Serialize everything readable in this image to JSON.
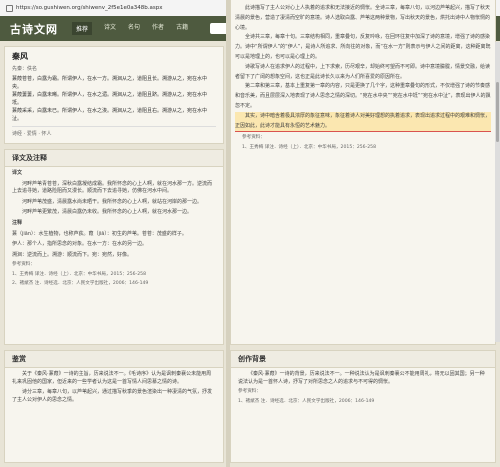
{
  "url": "https://so.gushiwen.org/shiwenv_2f5e1e0a348b.aspx",
  "site": {
    "logo": "古诗文网",
    "nav": [
      "推荐",
      "诗文",
      "名句",
      "作者",
      "古籍"
    ]
  },
  "poem": {
    "title": "秦风",
    "meta": "先秦：佚名",
    "lines": [
      "蒹葭苍苍，白露为霜。所谓伊人，在水一方。溯洄从之，道阻且长。溯游从之，宛在水中央。",
      "蒹葭萋萋，白露未晞。所谓伊人，在水之湄。溯洄从之，道阻且跻。溯游从之，宛在水中坻。",
      "蒹葭采采，白露未已。所谓伊人，在水之涘。溯洄从之，道阻且右。溯游从之，宛在水中沚。"
    ],
    "tags": "诗经 · 爱情 · 怀人"
  },
  "notes": {
    "header": "译文及注释",
    "sub": "译文",
    "text": [
      "河畔芦苇青苍苍，深秋白露凝结成霜。我所怀念的心上人啊，就在河水那一方。逆流而上去追寻她，道路险阻而又漫长。顺流而下去追寻她，仿佛在河水中间。",
      "河畔芦苇茂盛，清晨露水尚未晒干。我所怀念的心上人啊，就站在河岸的那一边。",
      "河畔芦苇更繁茂，清晨白露仍未收。我所怀念的心上人啊，就在河水那一边。"
    ],
    "ann": "注释",
    "notes_list": [
      "蒹（jiān）：水生植物，也称芦荻。葭（jiā）：初生的芦苇。苍苍：茂盛的样子。",
      "伊人：那个人，指所思念的对象。在水一方：在水的另一边。",
      "溯洄：逆流而上。溯游：顺流而下。宛：宛然，好像。"
    ],
    "refs": [
      "参考资料：",
      "1、王秀梅 译注．诗经（上）．北京：中华书局，2015：256-258",
      "2、褚斌杰 注．诗经选．北京：人民文学出版社，2006：146-149"
    ]
  },
  "appreciation": {
    "header": "鉴赏",
    "paragraphs": [
      "关于《秦风·蒹葭》一诗的主旨，历来说法不一。《毛诗序》认为是讽刺秦襄公未能用周礼来巩固他的国家，但近来的一些学者认为这是一首写情人间思慕之情的诗。",
      "诗分三章，每章八句，以芦苇起兴，通过描写秋季的景色渲染出一种凄清的气氛，抒发了主人公对伊人的思念之情。"
    ]
  },
  "right": {
    "paragraphs": [
      "此诗描写了主人公对心上人执着的追求和无法接近的惆怅。全诗三章，每章八句，以河边芦苇起兴，描写了秋天清晨的景色，营造了凄清而空旷的意境。诗人选取白露、芦苇这两种景物，写出秋天的景色，烘托出诗中人物怅惘的心境。",
      "全诗共三章，每章十句。三章结构相同，重章叠句，反复吟咏，在回环往复中加深了诗的意境，增强了诗的感染力。诗中“所谓伊人”的“伊人”，是诗人所追求、所向往的对象，而“在水一方”则表示与伊人之间的距离，这种距离既可以是地理上的，也可以是心理上的。",
      "诗歌写诗人在追求伊人的过程中，上下求索，历尽艰辛，却始终可望而不可即。诗中意境朦胧，情景交融，给读者留下了广阔的想象空间，这也正是此诗长久以来为人们所喜爱的原因所在。",
      "第二章和第三章，基本上重复第一章的内容，只是更换了几个字，这种重章叠句的形式，不仅增强了诗的节奏感和音乐美，而且层层深入地表现了诗人思念之情的深切。“宛在水中央”“宛在水中坻”“宛在水中沚”，表现出伊人的飘忽不定。",
      "其实，诗中暗含着极具浓厚的象征意味，象征着诗人对美好理想的执着追求，表现出追求过程中的艰难和惆怅，正因如此，此诗才能具有永恒的艺术魅力。"
    ],
    "highlight": "其实，诗中暗含着极具浓厚的象征意味，象征着诗人对美好理想的执着追求，表现出追求过程中的艰难和惆怅，正因如此，此诗才能具有永恒的艺术魅力。",
    "refs": [
      "参考资料：",
      "1、王秀梅 译注．诗经（上）．北京：中华书局，2015：256-258"
    ],
    "creation_header": "创作背景",
    "creation": "《秦风·蒹葭》一诗的背景，历来说法不一。一种说法认为是讽刺秦襄公不能用周礼，将无以固其国；另一种说法认为是一首怀人诗，抒写了对所思念之人的追求与不可得的惆怅。",
    "creation_refs": [
      "参考资料：",
      "1、褚斌杰 注．诗经选．北京：人民文学出版社，2006：146-149"
    ]
  },
  "colors": {
    "nav_bg": "#4e5a3f",
    "page_bg": "#e8e4d6",
    "panel_bg": "#f7f5ee",
    "highlight": "#fbe7b0"
  }
}
